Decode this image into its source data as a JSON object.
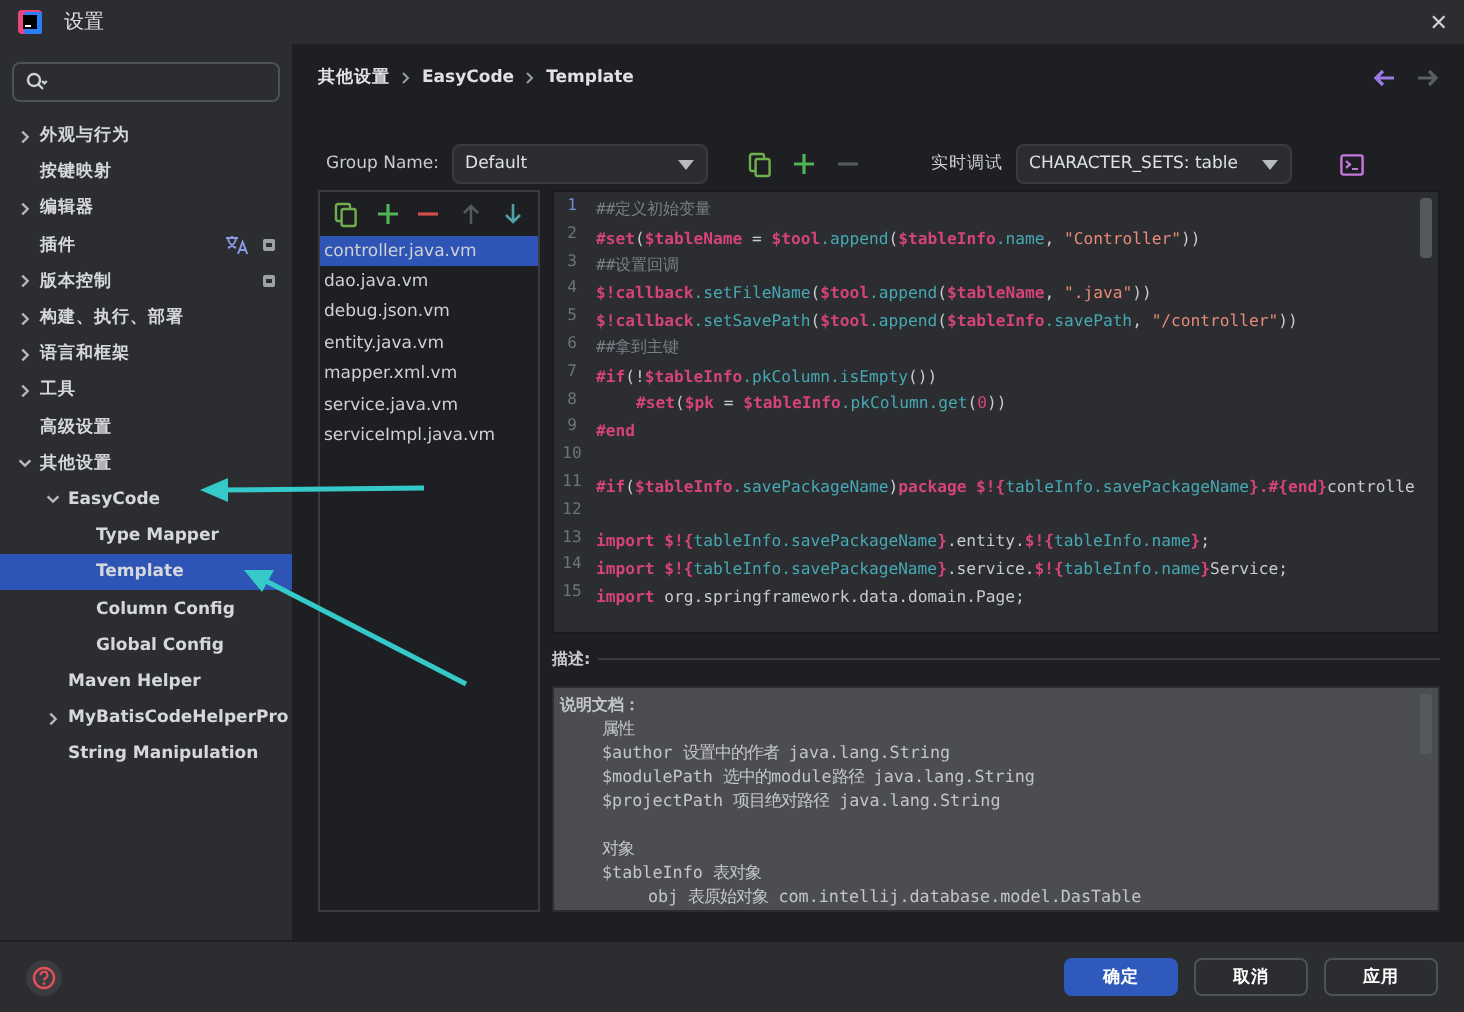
{
  "window": {
    "title": "设置",
    "close": "✕"
  },
  "sidebar": {
    "items": [
      {
        "label": "外观与行为",
        "expanded": false,
        "selected": false
      },
      {
        "label": "按键映射",
        "selected": false
      },
      {
        "label": "编辑器",
        "expanded": false,
        "selected": false
      },
      {
        "label": "插件",
        "selected": false,
        "has_translate": true,
        "has_badge": true
      },
      {
        "label": "版本控制",
        "expanded": false,
        "selected": false,
        "has_badge": true
      },
      {
        "label": "构建、执行、部署",
        "expanded": false,
        "selected": false
      },
      {
        "label": "语言和框架",
        "expanded": false,
        "selected": false
      },
      {
        "label": "工具",
        "expanded": false,
        "selected": false
      },
      {
        "label": "高级设置",
        "selected": false
      },
      {
        "label": "其他设置",
        "expanded": true,
        "selected": false,
        "children": [
          {
            "label": "EasyCode",
            "expanded": true,
            "selected": false,
            "children": [
              {
                "label": "Type Mapper",
                "selected": false
              },
              {
                "label": "Template",
                "selected": true
              },
              {
                "label": "Column Config",
                "selected": false
              },
              {
                "label": "Global Config",
                "selected": false
              }
            ]
          },
          {
            "label": "Maven Helper",
            "selected": false
          },
          {
            "label": "MyBatisCodeHelperPro",
            "expanded": false,
            "selected": false
          },
          {
            "label": "String Manipulation",
            "selected": false
          }
        ]
      }
    ]
  },
  "breadcrumb": [
    "其他设置",
    "EasyCode",
    "Template"
  ],
  "group": {
    "label": "Group Name:",
    "value": "Default"
  },
  "debug": {
    "label": "实时调试",
    "value": "CHARACTER_SETS: table"
  },
  "templates": [
    {
      "name": "controller.java.vm",
      "selected": true
    },
    {
      "name": "dao.java.vm",
      "selected": false
    },
    {
      "name": "debug.json.vm",
      "selected": false
    },
    {
      "name": "entity.java.vm",
      "selected": false
    },
    {
      "name": "mapper.xml.vm",
      "selected": false
    },
    {
      "name": "service.java.vm",
      "selected": false
    },
    {
      "name": "serviceImpl.java.vm",
      "selected": false
    }
  ],
  "code": [
    {
      "number": "1",
      "segments": [
        {
          "kind": "comment",
          "text": "##定义初始变量"
        }
      ]
    },
    {
      "number": "2",
      "segments": [
        {
          "kind": "kw",
          "text": "#set"
        },
        {
          "kind": "plain",
          "text": "("
        },
        {
          "kind": "kw",
          "text": "$tableName"
        },
        {
          "kind": "plain",
          "text": " = "
        },
        {
          "kind": "kw",
          "text": "$tool"
        },
        {
          "kind": "fn",
          "text": ".append"
        },
        {
          "kind": "plain",
          "text": "("
        },
        {
          "kind": "kw",
          "text": "$tableInfo"
        },
        {
          "kind": "fn",
          "text": ".name"
        },
        {
          "kind": "plain",
          "text": ", "
        },
        {
          "kind": "str",
          "text": "\"Controller\""
        },
        {
          "kind": "plain",
          "text": "))"
        }
      ]
    },
    {
      "number": "3",
      "segments": [
        {
          "kind": "comment",
          "text": "##设置回调"
        }
      ]
    },
    {
      "number": "4",
      "segments": [
        {
          "kind": "kw",
          "text": "$!callback"
        },
        {
          "kind": "fn",
          "text": ".setFileName"
        },
        {
          "kind": "plain",
          "text": "("
        },
        {
          "kind": "kw",
          "text": "$tool"
        },
        {
          "kind": "fn",
          "text": ".append"
        },
        {
          "kind": "plain",
          "text": "("
        },
        {
          "kind": "kw",
          "text": "$tableName"
        },
        {
          "kind": "plain",
          "text": ", "
        },
        {
          "kind": "str",
          "text": "\".java\""
        },
        {
          "kind": "plain",
          "text": "))"
        }
      ]
    },
    {
      "number": "5",
      "segments": [
        {
          "kind": "kw",
          "text": "$!callback"
        },
        {
          "kind": "fn",
          "text": ".setSavePath"
        },
        {
          "kind": "plain",
          "text": "("
        },
        {
          "kind": "kw",
          "text": "$tool"
        },
        {
          "kind": "fn",
          "text": ".append"
        },
        {
          "kind": "plain",
          "text": "("
        },
        {
          "kind": "kw",
          "text": "$tableInfo"
        },
        {
          "kind": "fn",
          "text": ".savePath"
        },
        {
          "kind": "plain",
          "text": ", "
        },
        {
          "kind": "str",
          "text": "\"/controller\""
        },
        {
          "kind": "plain",
          "text": "))"
        }
      ]
    },
    {
      "number": "6",
      "segments": [
        {
          "kind": "comment",
          "text": "##拿到主键"
        }
      ]
    },
    {
      "number": "7",
      "segments": [
        {
          "kind": "kw",
          "text": "#if"
        },
        {
          "kind": "plain",
          "text": "(!"
        },
        {
          "kind": "kw",
          "text": "$tableInfo"
        },
        {
          "kind": "fn",
          "text": ".pkColumn.isEmpty"
        },
        {
          "kind": "plain",
          "text": "())"
        }
      ]
    },
    {
      "number": "8",
      "indented": true,
      "segments": [
        {
          "kind": "kw",
          "text": "#set"
        },
        {
          "kind": "plain",
          "text": "("
        },
        {
          "kind": "kw",
          "text": "$pk"
        },
        {
          "kind": "plain",
          "text": " = "
        },
        {
          "kind": "kw",
          "text": "$tableInfo"
        },
        {
          "kind": "fn",
          "text": ".pkColumn.get"
        },
        {
          "kind": "plain",
          "text": "("
        },
        {
          "kind": "num",
          "text": "0"
        },
        {
          "kind": "plain",
          "text": "))"
        }
      ]
    },
    {
      "number": "9",
      "segments": [
        {
          "kind": "kw",
          "text": "#end"
        }
      ]
    },
    {
      "number": "10"
    },
    {
      "number": "11",
      "segments": [
        {
          "kind": "kw",
          "text": "#if"
        },
        {
          "kind": "plain",
          "text": "("
        },
        {
          "kind": "kw",
          "text": "$tableInfo"
        },
        {
          "kind": "fn",
          "text": ".savePackageName"
        },
        {
          "kind": "plain",
          "text": ")"
        },
        {
          "kind": "kw",
          "text": "package $!{"
        },
        {
          "kind": "fn",
          "text": "tableInfo.savePackageName"
        },
        {
          "kind": "kw",
          "text": "}.#{end}"
        },
        {
          "kind": "plain",
          "text": "controlle"
        }
      ]
    },
    {
      "number": "12"
    },
    {
      "number": "13",
      "segments": [
        {
          "kind": "kw",
          "text": "import $!{"
        },
        {
          "kind": "fn",
          "text": "tableInfo.savePackageName"
        },
        {
          "kind": "kw",
          "text": "}"
        },
        {
          "kind": "plain",
          "text": ".entity."
        },
        {
          "kind": "kw",
          "text": "$!{"
        },
        {
          "kind": "fn",
          "text": "tableInfo.name"
        },
        {
          "kind": "kw",
          "text": "}"
        },
        {
          "kind": "plain",
          "text": ";"
        }
      ]
    },
    {
      "number": "14",
      "segments": [
        {
          "kind": "kw",
          "text": "import $!{"
        },
        {
          "kind": "fn",
          "text": "tableInfo.savePackageName"
        },
        {
          "kind": "kw",
          "text": "}"
        },
        {
          "kind": "plain",
          "text": ".service."
        },
        {
          "kind": "kw",
          "text": "$!{"
        },
        {
          "kind": "fn",
          "text": "tableInfo.name"
        },
        {
          "kind": "kw",
          "text": "}"
        },
        {
          "kind": "plain",
          "text": "Service;"
        }
      ]
    },
    {
      "number": "15",
      "segments": [
        {
          "kind": "kw",
          "text": "import"
        },
        {
          "kind": "plain",
          "text": " org.springframework.data.domain.Page;"
        }
      ]
    }
  ],
  "description": {
    "label": "描述:",
    "lines": [
      {
        "kind": "heading",
        "text": "说明文档："
      },
      {
        "kind": "line",
        "text": "属性"
      },
      {
        "kind": "line",
        "text": "$author 设置中的作者 java.lang.String"
      },
      {
        "kind": "line",
        "text": "$modulePath 选中的module路径 java.lang.String"
      },
      {
        "kind": "line",
        "text": "$projectPath 项目绝对路径 java.lang.String"
      },
      {
        "kind": "blank"
      },
      {
        "kind": "line",
        "text": "对象"
      },
      {
        "kind": "line",
        "text": "$tableInfo 表对象"
      },
      {
        "kind": "subline",
        "text": "obj 表原始对象 com.intellij.database.model.DasTable"
      }
    ]
  },
  "buttons": [
    {
      "label": "确定",
      "primary": true
    },
    {
      "label": "取消",
      "primary": false
    },
    {
      "label": "应用",
      "primary": false
    }
  ]
}
